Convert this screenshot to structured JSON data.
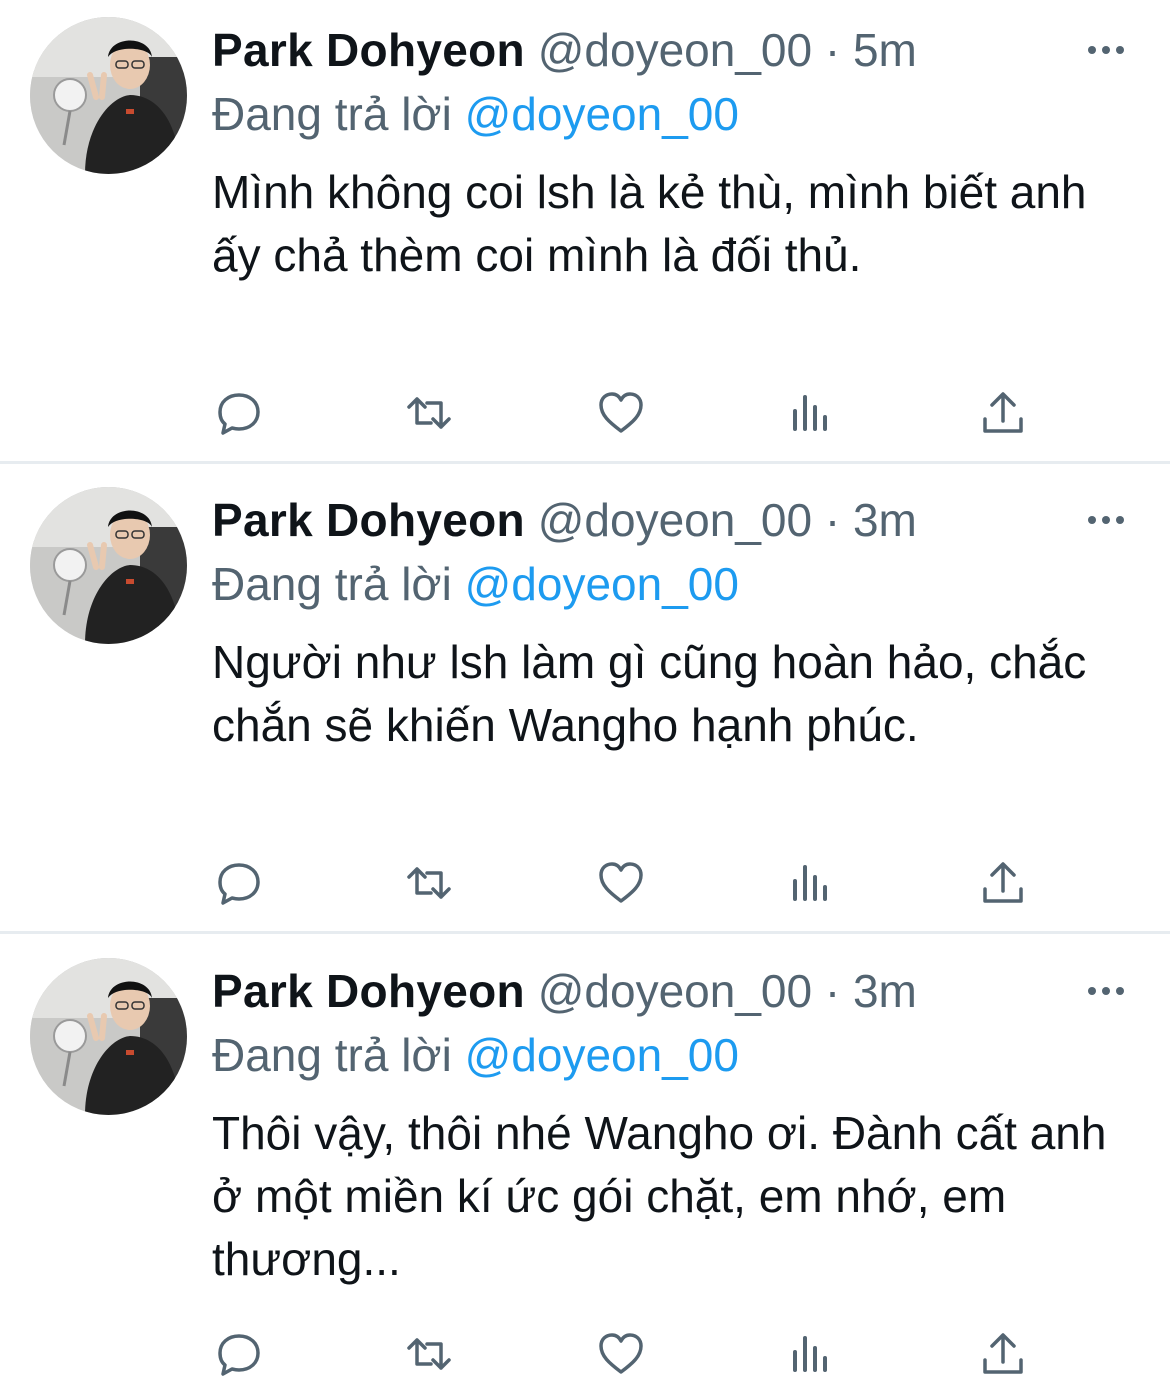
{
  "tweets": [
    {
      "author": "Park Dohyeon",
      "handle": "@doyeon_00",
      "separator": "·",
      "time": "5m",
      "replying_prefix": "Đang trả lời",
      "replying_to": "@doyeon_00",
      "text": "Mình không coi lsh là kẻ thù, mình biết anh ấy chả thèm coi mình là đối thủ."
    },
    {
      "author": "Park Dohyeon",
      "handle": "@doyeon_00",
      "separator": "·",
      "time": "3m",
      "replying_prefix": "Đang trả lời",
      "replying_to": "@doyeon_00",
      "text": "Người như lsh làm gì cũng hoàn hảo, chắc chắn sẽ khiến Wangho hạnh phúc."
    },
    {
      "author": "Park Dohyeon",
      "handle": "@doyeon_00",
      "separator": "·",
      "time": "3m",
      "replying_prefix": "Đang trả lời",
      "replying_to": "@doyeon_00",
      "text": "Thôi vậy, thôi nhé Wangho ơi. Đành cất anh ở một miền kí ức gói chặt, em nhớ, em thương..."
    }
  ],
  "icons": {
    "more": "more-dots-icon",
    "reply": "reply-bubble-icon",
    "retweet": "retweet-icon",
    "like": "heart-icon",
    "analytics": "analytics-bars-icon",
    "share": "share-upload-icon"
  },
  "colors": {
    "text": "#0f1419",
    "secondary": "#536471",
    "link": "#1d9bf0",
    "divider": "#e7ecf0"
  }
}
